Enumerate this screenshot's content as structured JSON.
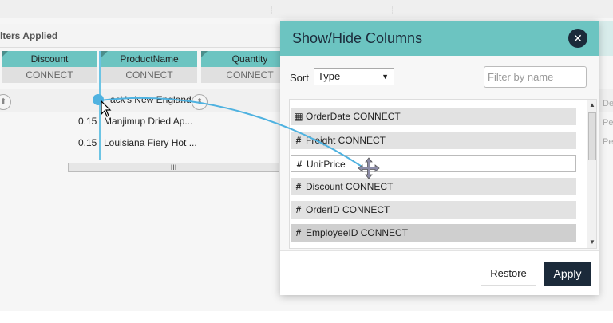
{
  "background": {
    "filters_label": "lters Applied",
    "columns": [
      {
        "name": "Discount",
        "source": "CONNECT"
      },
      {
        "name": "ProductName",
        "source": "CONNECT"
      },
      {
        "name": "Quantity",
        "source": "CONNECT"
      }
    ],
    "filter_text": "ack's New England ...",
    "rows": [
      {
        "discount": "0.15",
        "product": "Manjimup Dried Ap..."
      },
      {
        "discount": "0.15",
        "product": "Louisiana Fiery Hot ..."
      }
    ],
    "scroll_grip": "III",
    "right_stub": [
      "De",
      "Pe",
      "Pe"
    ]
  },
  "dialog": {
    "title": "Show/Hide Columns",
    "sort_label": "Sort",
    "sort_value": "Type",
    "filter_placeholder": "Filter by name",
    "items": [
      {
        "icon": "calendar-icon",
        "label": "OrderDate CONNECT"
      },
      {
        "icon": "hash-icon",
        "label": "Freight CONNECT"
      },
      {
        "icon": "hash-icon",
        "label": "UnitPrice"
      },
      {
        "icon": "hash-icon",
        "label": "Discount CONNECT"
      },
      {
        "icon": "hash-icon",
        "label": "OrderID CONNECT"
      },
      {
        "icon": "hash-icon",
        "label": "EmployeeID CONNECT"
      }
    ],
    "restore_label": "Restore",
    "apply_label": "Apply"
  },
  "colors": {
    "teal": "#6cc4c1",
    "navy": "#1b2a3a",
    "drag_blue": "#4fb2e0"
  }
}
